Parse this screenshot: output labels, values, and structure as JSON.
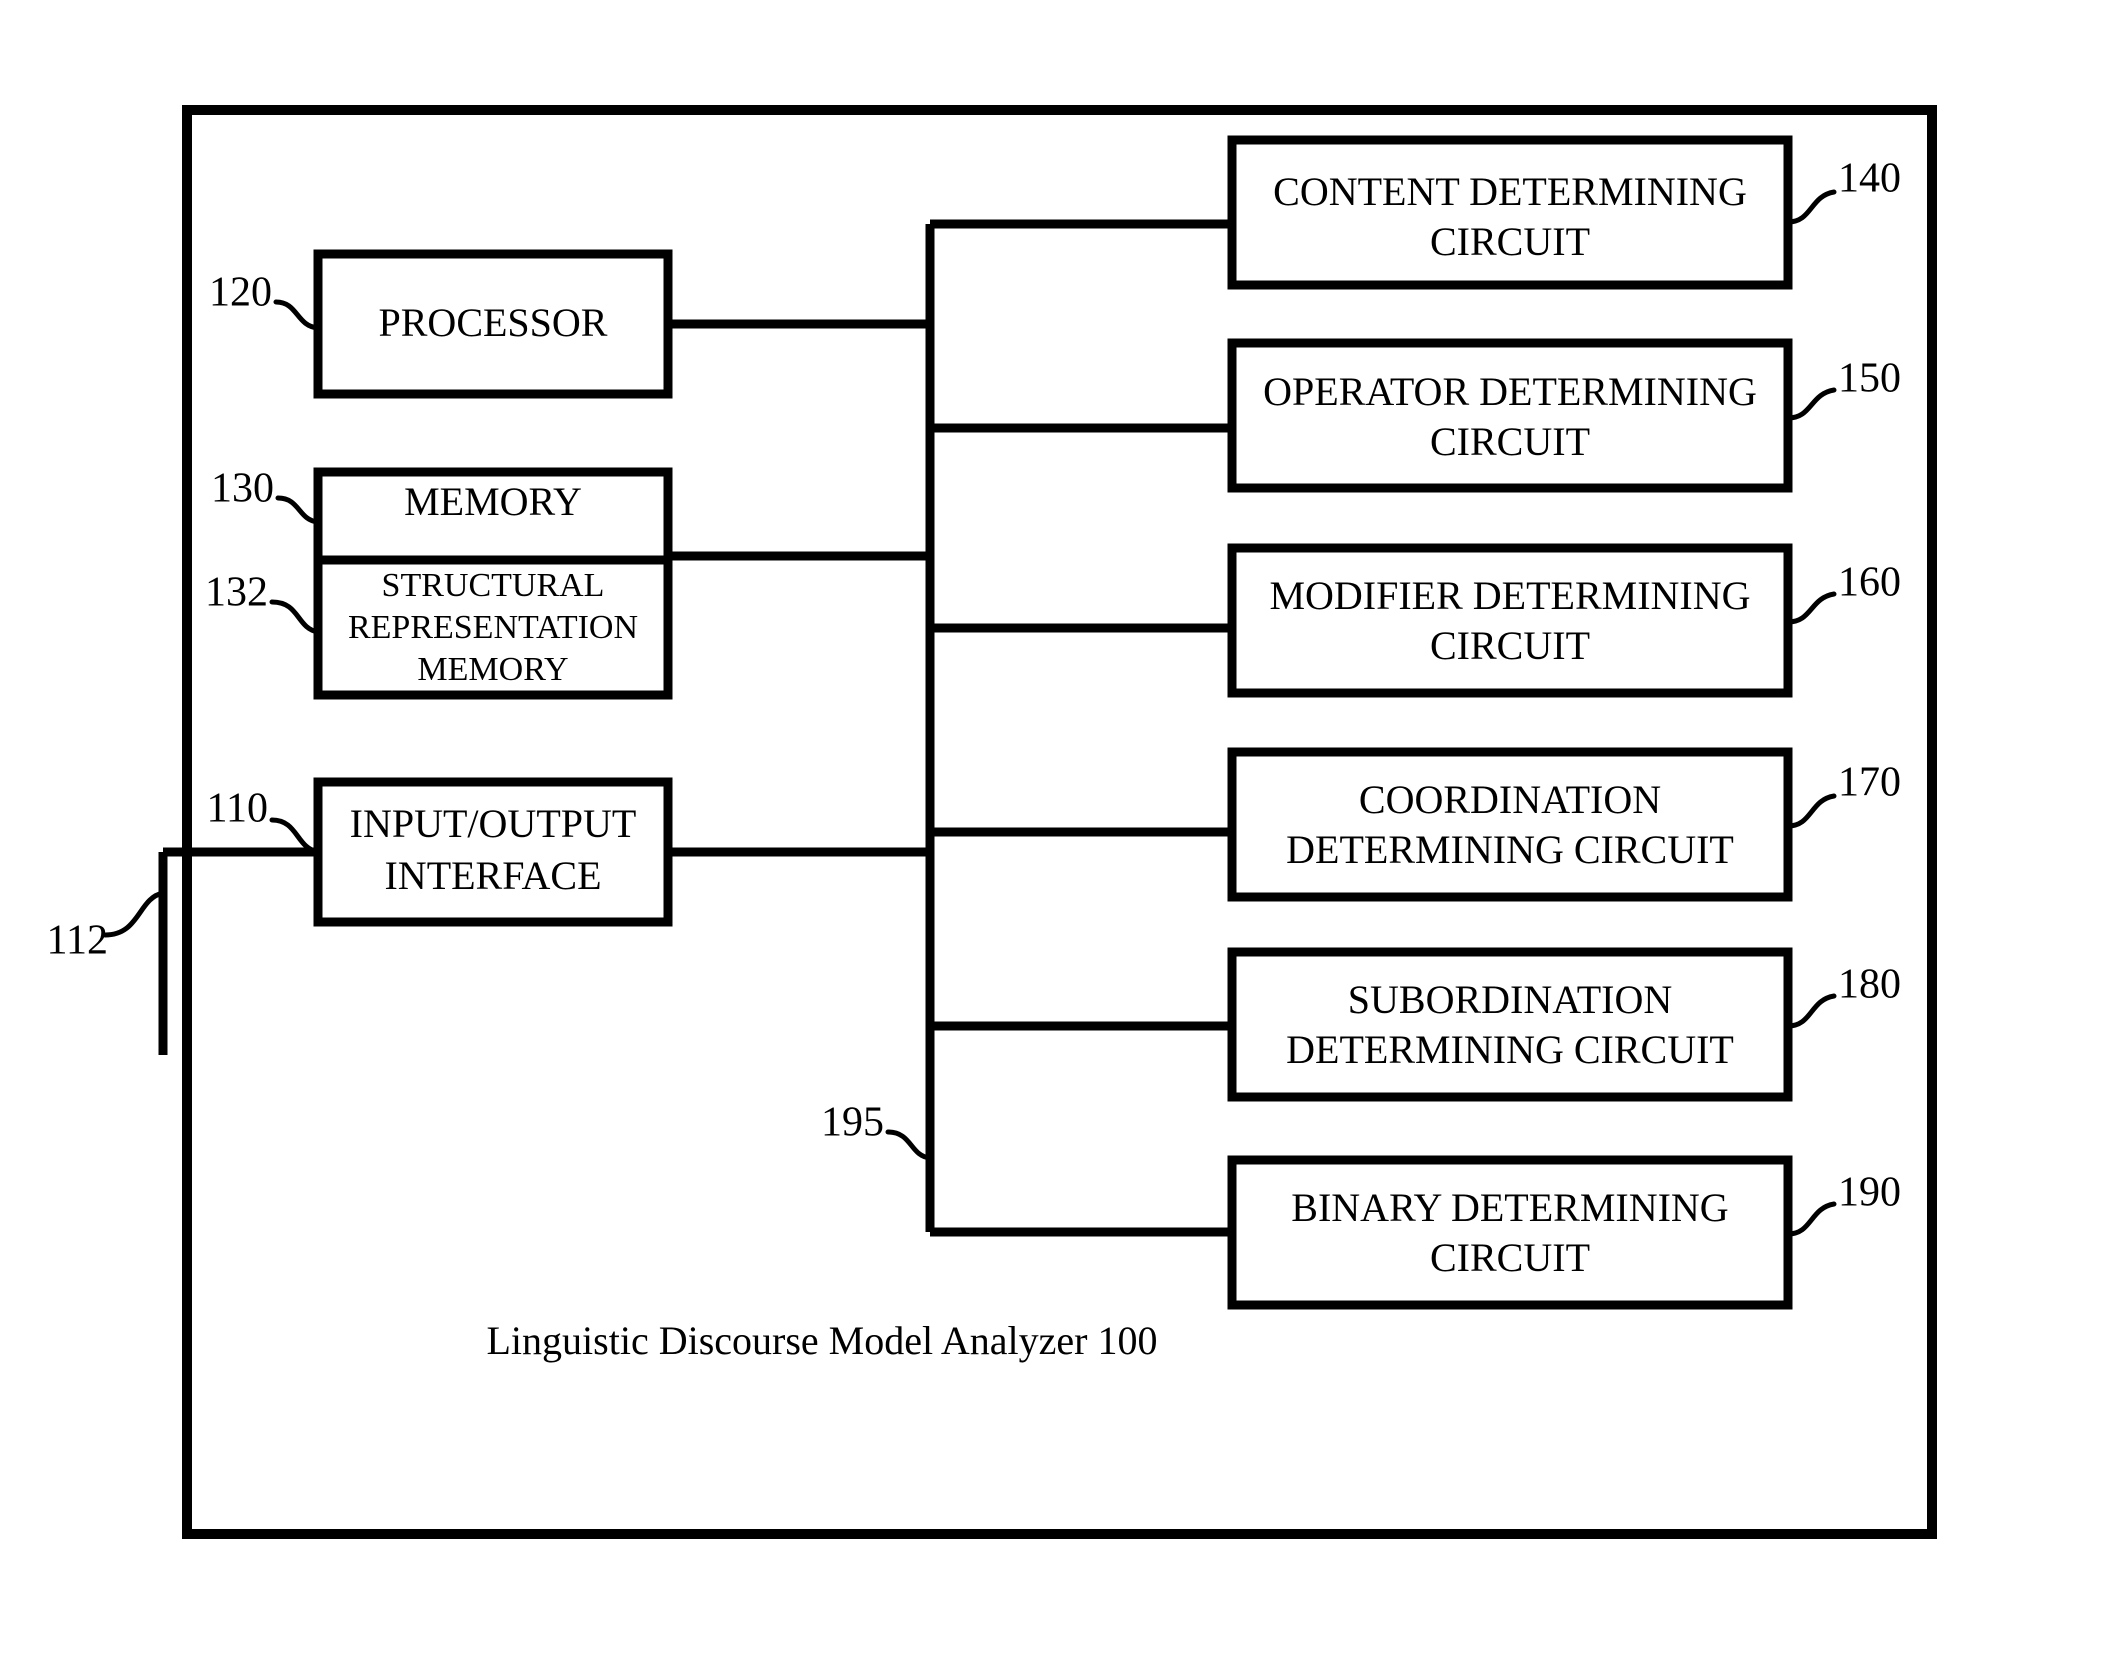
{
  "figure": {
    "caption": "Linguistic Discourse Model Analyzer 100",
    "outer_frame_ref": "100"
  },
  "left_blocks": [
    {
      "id": "processor",
      "ref": "120",
      "lines": [
        "PROCESSOR"
      ]
    },
    {
      "id": "memory",
      "ref": "130",
      "lines": [
        "MEMORY"
      ]
    },
    {
      "id": "structural-representation-memory",
      "ref": "132",
      "lines": [
        "STRUCTURAL",
        "REPRESENTATION",
        "MEMORY"
      ]
    },
    {
      "id": "input-output-interface",
      "ref": "110",
      "lines": [
        "INPUT/OUTPUT",
        "INTERFACE"
      ]
    }
  ],
  "external_link": {
    "ref": "112"
  },
  "bus": {
    "ref": "195"
  },
  "right_blocks": [
    {
      "id": "content-determining-circuit",
      "ref": "140",
      "lines": [
        "CONTENT DETERMINING",
        "CIRCUIT"
      ]
    },
    {
      "id": "operator-determining-circuit",
      "ref": "150",
      "lines": [
        "OPERATOR DETERMINING",
        "CIRCUIT"
      ]
    },
    {
      "id": "modifier-determining-circuit",
      "ref": "160",
      "lines": [
        "MODIFIER DETERMINING",
        "CIRCUIT"
      ]
    },
    {
      "id": "coordination-determining-circuit",
      "ref": "170",
      "lines": [
        "COORDINATION",
        "DETERMINING CIRCUIT"
      ]
    },
    {
      "id": "subordination-determining-circuit",
      "ref": "180",
      "lines": [
        "SUBORDINATION",
        "DETERMINING CIRCUIT"
      ]
    },
    {
      "id": "binary-determining-circuit",
      "ref": "190",
      "lines": [
        "BINARY DETERMINING",
        "CIRCUIT"
      ]
    }
  ],
  "colors": {
    "ink": "#000000",
    "paper": "#ffffff"
  }
}
